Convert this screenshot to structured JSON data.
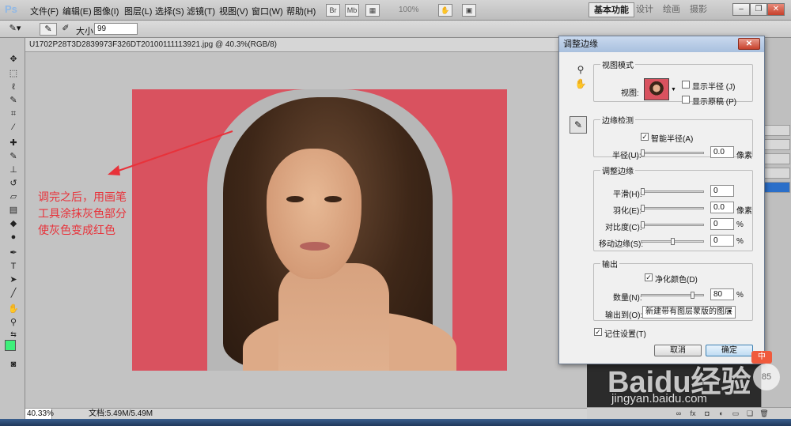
{
  "menubar": {
    "logo": "Ps",
    "menus": [
      "文件(F)",
      "编辑(E)",
      "图像(I)",
      "图层(L)",
      "选择(S)",
      "滤镜(T)",
      "视图(V)",
      "窗口(W)",
      "帮助(H)"
    ],
    "zoom": "100%",
    "workspaces": [
      "基本功能",
      "设计",
      "绘画",
      "摄影"
    ]
  },
  "options": {
    "size_label": "大小:",
    "size_value": "99"
  },
  "document": {
    "tab_title": "U1702P28T3D2839973F326DT20100111113921.jpg @ 40.3%(RGB/8)",
    "annotation_lines": [
      "调完之后，用画笔",
      "工具涂抹灰色部分",
      "使灰色变成红色"
    ],
    "status_zoom": "40.33%",
    "status_doc": "文档:5.49M/5.49M"
  },
  "dialog": {
    "title": "调整边缘",
    "view_mode": {
      "legend": "视图模式",
      "view_label": "视图:",
      "show_radius": "显示半径 (J)",
      "show_original": "显示原稿 (P)",
      "show_radius_checked": false,
      "show_original_checked": false
    },
    "edge_detection": {
      "legend": "边缘检测",
      "smart_radius": "智能半径(A)",
      "smart_radius_checked": true,
      "radius_label": "半径(U):",
      "radius_value": "0.0",
      "radius_unit": "像素"
    },
    "adjust_edge": {
      "legend": "调整边缘",
      "smooth_label": "平滑(H):",
      "smooth_value": "0",
      "feather_label": "羽化(E):",
      "feather_value": "0.0",
      "feather_unit": "像素",
      "contrast_label": "对比度(C):",
      "contrast_value": "0",
      "contrast_unit": "%",
      "shift_label": "移动边缘(S):",
      "shift_value": "0",
      "shift_unit": "%"
    },
    "output": {
      "legend": "输出",
      "decontaminate": "净化颜色(D)",
      "decontaminate_checked": true,
      "amount_label": "数量(N):",
      "amount_value": "80",
      "amount_unit": "%",
      "output_to_label": "输出到(O):",
      "output_to_value": "新建带有图层蒙版的图层"
    },
    "remember": "记住设置(T)",
    "remember_checked": true,
    "cancel_label": "取消",
    "ok_label": "确定"
  },
  "watermark": {
    "brand": "Baidu经验",
    "url": "jingyan.baidu.com"
  },
  "colors": {
    "foreground": "#3df07a",
    "background": "#ffffff",
    "image_bg": "#d9525f",
    "annotation": "#e8323a"
  }
}
